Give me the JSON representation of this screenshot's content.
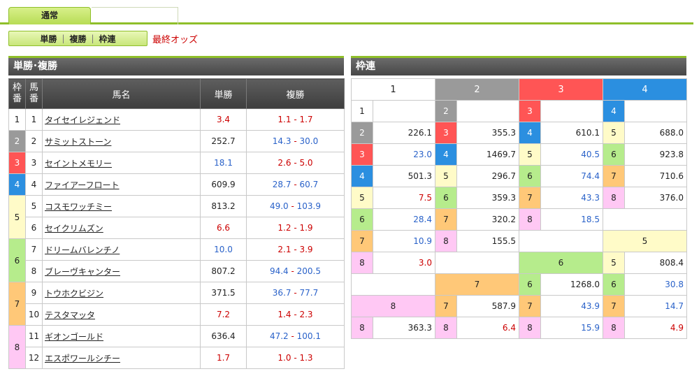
{
  "tabs": {
    "main": "通常"
  },
  "subnav": {
    "tan": "単勝",
    "fuku": "複勝",
    "waku": "枠連",
    "sep": "|"
  },
  "final_odds": "最終オッズ",
  "left": {
    "title": "単勝･複勝",
    "headers": {
      "waku": "枠\n番",
      "uma": "馬\n番",
      "name": "馬名",
      "tan": "単勝",
      "fuku": "複勝"
    },
    "rows": [
      {
        "waku": "1",
        "uma": "1",
        "name": "タイセイレジェンド",
        "tan": "3.4",
        "tan_color": "red",
        "f1": "1.1",
        "f2": "1.7",
        "f_color": "red"
      },
      {
        "waku": "2",
        "uma": "2",
        "name": "サミットストーン",
        "tan": "252.7",
        "tan_color": "blk",
        "f1": "14.3",
        "f2": "30.0",
        "f_color": "blue"
      },
      {
        "waku": "3",
        "uma": "3",
        "name": "セイントメモリー",
        "tan": "18.1",
        "tan_color": "blue",
        "f1": "2.6",
        "f2": "5.0",
        "f_color": "red"
      },
      {
        "waku": "4",
        "uma": "4",
        "name": "ファイアーフロート",
        "tan": "609.9",
        "tan_color": "blk",
        "f1": "28.7",
        "f2": "60.7",
        "f_color": "blue"
      },
      {
        "waku": "5",
        "uma": "5",
        "name": "コスモワッチミー",
        "tan": "813.2",
        "tan_color": "blk",
        "f1": "49.0",
        "f2": "103.9",
        "f_color": "blue"
      },
      {
        "waku": "5",
        "uma": "6",
        "name": "セイクリムズン",
        "tan": "6.6",
        "tan_color": "red",
        "f1": "1.2",
        "f2": "1.9",
        "f_color": "red"
      },
      {
        "waku": "6",
        "uma": "7",
        "name": "ドリームバレンチノ",
        "tan": "10.0",
        "tan_color": "blue",
        "f1": "2.1",
        "f2": "3.9",
        "f_color": "red"
      },
      {
        "waku": "6",
        "uma": "8",
        "name": "ブレーヴキャンター",
        "tan": "807.2",
        "tan_color": "blk",
        "f1": "94.4",
        "f2": "200.5",
        "f_color": "blue"
      },
      {
        "waku": "7",
        "uma": "9",
        "name": "トウホクビジン",
        "tan": "371.5",
        "tan_color": "blk",
        "f1": "36.7",
        "f2": "77.7",
        "f_color": "blue"
      },
      {
        "waku": "7",
        "uma": "10",
        "name": "テスタマッタ",
        "tan": "7.2",
        "tan_color": "red",
        "f1": "1.4",
        "f2": "2.3",
        "f_color": "red"
      },
      {
        "waku": "8",
        "uma": "11",
        "name": "ギオンゴールド",
        "tan": "636.4",
        "tan_color": "blk",
        "f1": "47.2",
        "f2": "100.1",
        "f_color": "blue"
      },
      {
        "waku": "8",
        "uma": "12",
        "name": "エスポワールシチー",
        "tan": "1.7",
        "tan_color": "red",
        "f1": "1.0",
        "f2": "1.3",
        "f_color": "red"
      }
    ]
  },
  "right": {
    "title": "枠連",
    "col_heads": [
      "1",
      "2",
      "3",
      "4"
    ],
    "pairs": {
      "1-1": "",
      "1-2": "226.1",
      "1-3": "23.0",
      "1-4": "501.3",
      "1-5": "7.5",
      "1-6": "28.4",
      "1-7": "10.9",
      "1-8": "3.0",
      "2-2": "",
      "2-3": "355.3",
      "2-4": "1469.7",
      "2-5": "296.7",
      "2-6": "359.3",
      "2-7": "320.2",
      "2-8": "155.5",
      "3-3": "",
      "3-4": "610.1",
      "3-5": "40.5",
      "3-6": "74.4",
      "3-7": "43.3",
      "3-8": "18.5",
      "4-4": "",
      "4-5": "688.0",
      "4-6": "923.8",
      "4-7": "710.6",
      "4-8": "376.0",
      "5-5": "",
      "5-6": "808.4",
      "5-7": "30.8",
      "5-8": "14.7",
      "5-8b": "4.9",
      "6-6": "",
      "6-7": "1268.0",
      "6-8": "43.9",
      "6-8b": "15.9",
      "7-7": "",
      "7-8": "587.9",
      "7-8b": "6.4",
      "8-8": "363.3"
    },
    "colors": {
      "1-1": "blk",
      "1-2": "blk",
      "1-3": "blue",
      "1-4": "blk",
      "1-5": "red",
      "1-6": "blue",
      "1-7": "blue",
      "1-8": "red",
      "2-3": "blk",
      "2-4": "blk",
      "2-5": "blk",
      "2-6": "blk",
      "2-7": "blk",
      "2-8": "blk",
      "3-4": "blk",
      "3-5": "blue",
      "3-6": "blue",
      "3-7": "blue",
      "3-8": "blue",
      "4-5": "blk",
      "4-6": "blk",
      "4-7": "blk",
      "4-8": "blk"
    }
  }
}
